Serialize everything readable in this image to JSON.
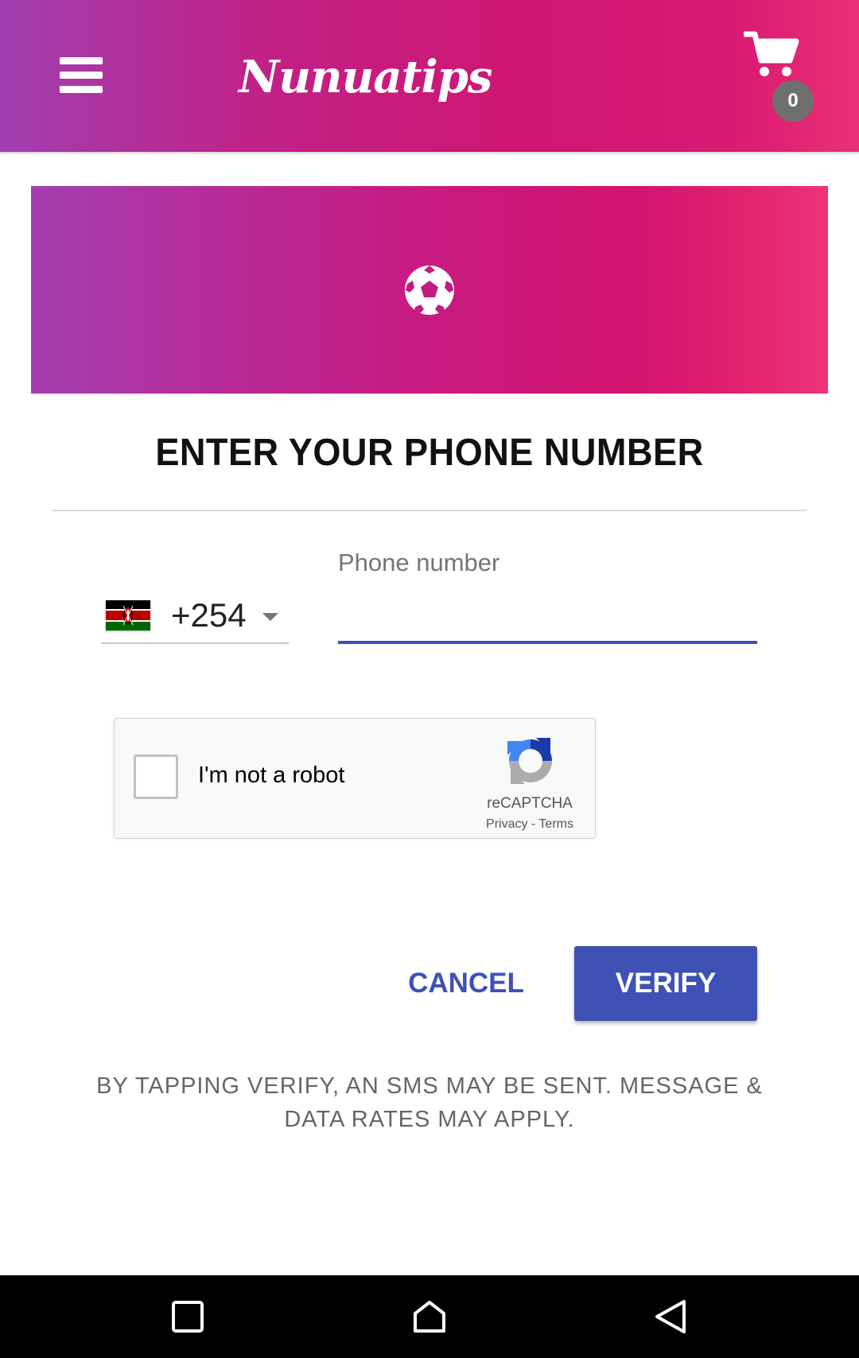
{
  "app_bar": {
    "title": "Nunuatips",
    "menu_icon": "hamburger-menu-icon",
    "cart_icon": "shopping-cart-icon",
    "cart_count": "0"
  },
  "banner": {
    "icon": "soccer-ball-icon"
  },
  "dialog": {
    "title": "ENTER YOUR PHONE NUMBER",
    "country": {
      "flag_icon": "kenya-flag-icon",
      "code": "+254"
    },
    "phone": {
      "label": "Phone number",
      "value": ""
    },
    "recaptcha": {
      "label": "I'm not a robot",
      "brand": "reCAPTCHA",
      "links": "Privacy - Terms"
    },
    "cancel_label": "CANCEL",
    "verify_label": "VERIFY",
    "disclaimer": "BY TAPPING VERIFY, AN SMS MAY BE SENT. MESSAGE & DATA RATES MAY APPLY."
  },
  "nav_bar": {
    "recents_icon": "recents-square-icon",
    "home_icon": "home-icon",
    "back_icon": "back-triangle-icon"
  },
  "colors": {
    "accent": "#3f51b5",
    "header_gradient_start": "#a13fb1",
    "header_gradient_end": "#ea3076"
  }
}
